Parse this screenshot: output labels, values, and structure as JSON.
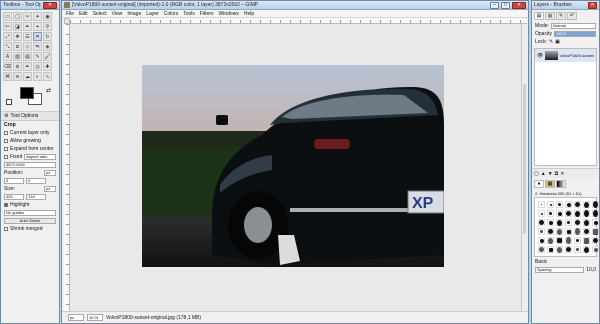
{
  "toolbox": {
    "title": "Toolbox - Tool Opti...",
    "tools": [
      "rect-select",
      "ellipse-select",
      "free-select",
      "fuzzy-select",
      "color-select",
      "scissors",
      "foreground-select",
      "paths",
      "color-picker",
      "zoom",
      "measure",
      "move",
      "align",
      "crop",
      "rotate",
      "scale",
      "shear",
      "perspective",
      "flip",
      "cage",
      "text",
      "bucket-fill",
      "blend",
      "pencil",
      "paintbrush",
      "eraser",
      "airbrush",
      "ink",
      "clone",
      "heal",
      "perspective-clone",
      "blur",
      "smudge",
      "dodge-burn",
      "fuzzy"
    ],
    "tool_options_label": "Tool Options",
    "section": "Crop",
    "options": [
      {
        "label": "Current layer only",
        "checked": false
      },
      {
        "label": "Allow growing",
        "checked": false
      },
      {
        "label": "Expand from center",
        "checked": false
      }
    ],
    "fixed_label": "Fixed",
    "fixed_value": "Aspect ratio",
    "ratio_value": "3872:2592",
    "position_label": "Position:",
    "position_unit": "px",
    "position_x": "0",
    "position_y": "0",
    "size_label": "Size:",
    "size_unit": "px",
    "size_w": "400",
    "size_h": "134",
    "highlight_label": "Highlight",
    "guides_value": "No guides",
    "auto_shrink_label": "Auto Shrink",
    "shrink_merged_label": "Shrink merged",
    "fg_color": "#000000",
    "bg_color": "#ffffff"
  },
  "image_window": {
    "title": "[VolvoP1800-sunset-original] (imported)-1.0 (RGB color, 1 layer) 3872x2592 – GIMP",
    "menu": [
      "File",
      "Edit",
      "Select",
      "View",
      "Image",
      "Layer",
      "Colors",
      "Tools",
      "Filters",
      "Windows",
      "Help"
    ],
    "status_unit": "px",
    "zoom": "15 %",
    "status_text": "VolvoP1800-sunset-original.jpg (178,1 MB)"
  },
  "layers": {
    "title": "Layers - Brushes",
    "mode_label": "Mode:",
    "mode_value": "Normal",
    "opacity_label": "Opacity",
    "opacity_value": "100,0",
    "lock_label": "Lock:",
    "layer_name": "VolvoP1800-sunset",
    "brushes_header": "2. Hardness 050 (51 × 51)",
    "spacing_label": "Spacing",
    "spacing_value": "10,0",
    "basic_label": "Basic"
  },
  "colors": {
    "ui_bg": "#f0f0f0",
    "title_gradient_top": "#dbe8f6",
    "close_red": "#c9463d"
  }
}
